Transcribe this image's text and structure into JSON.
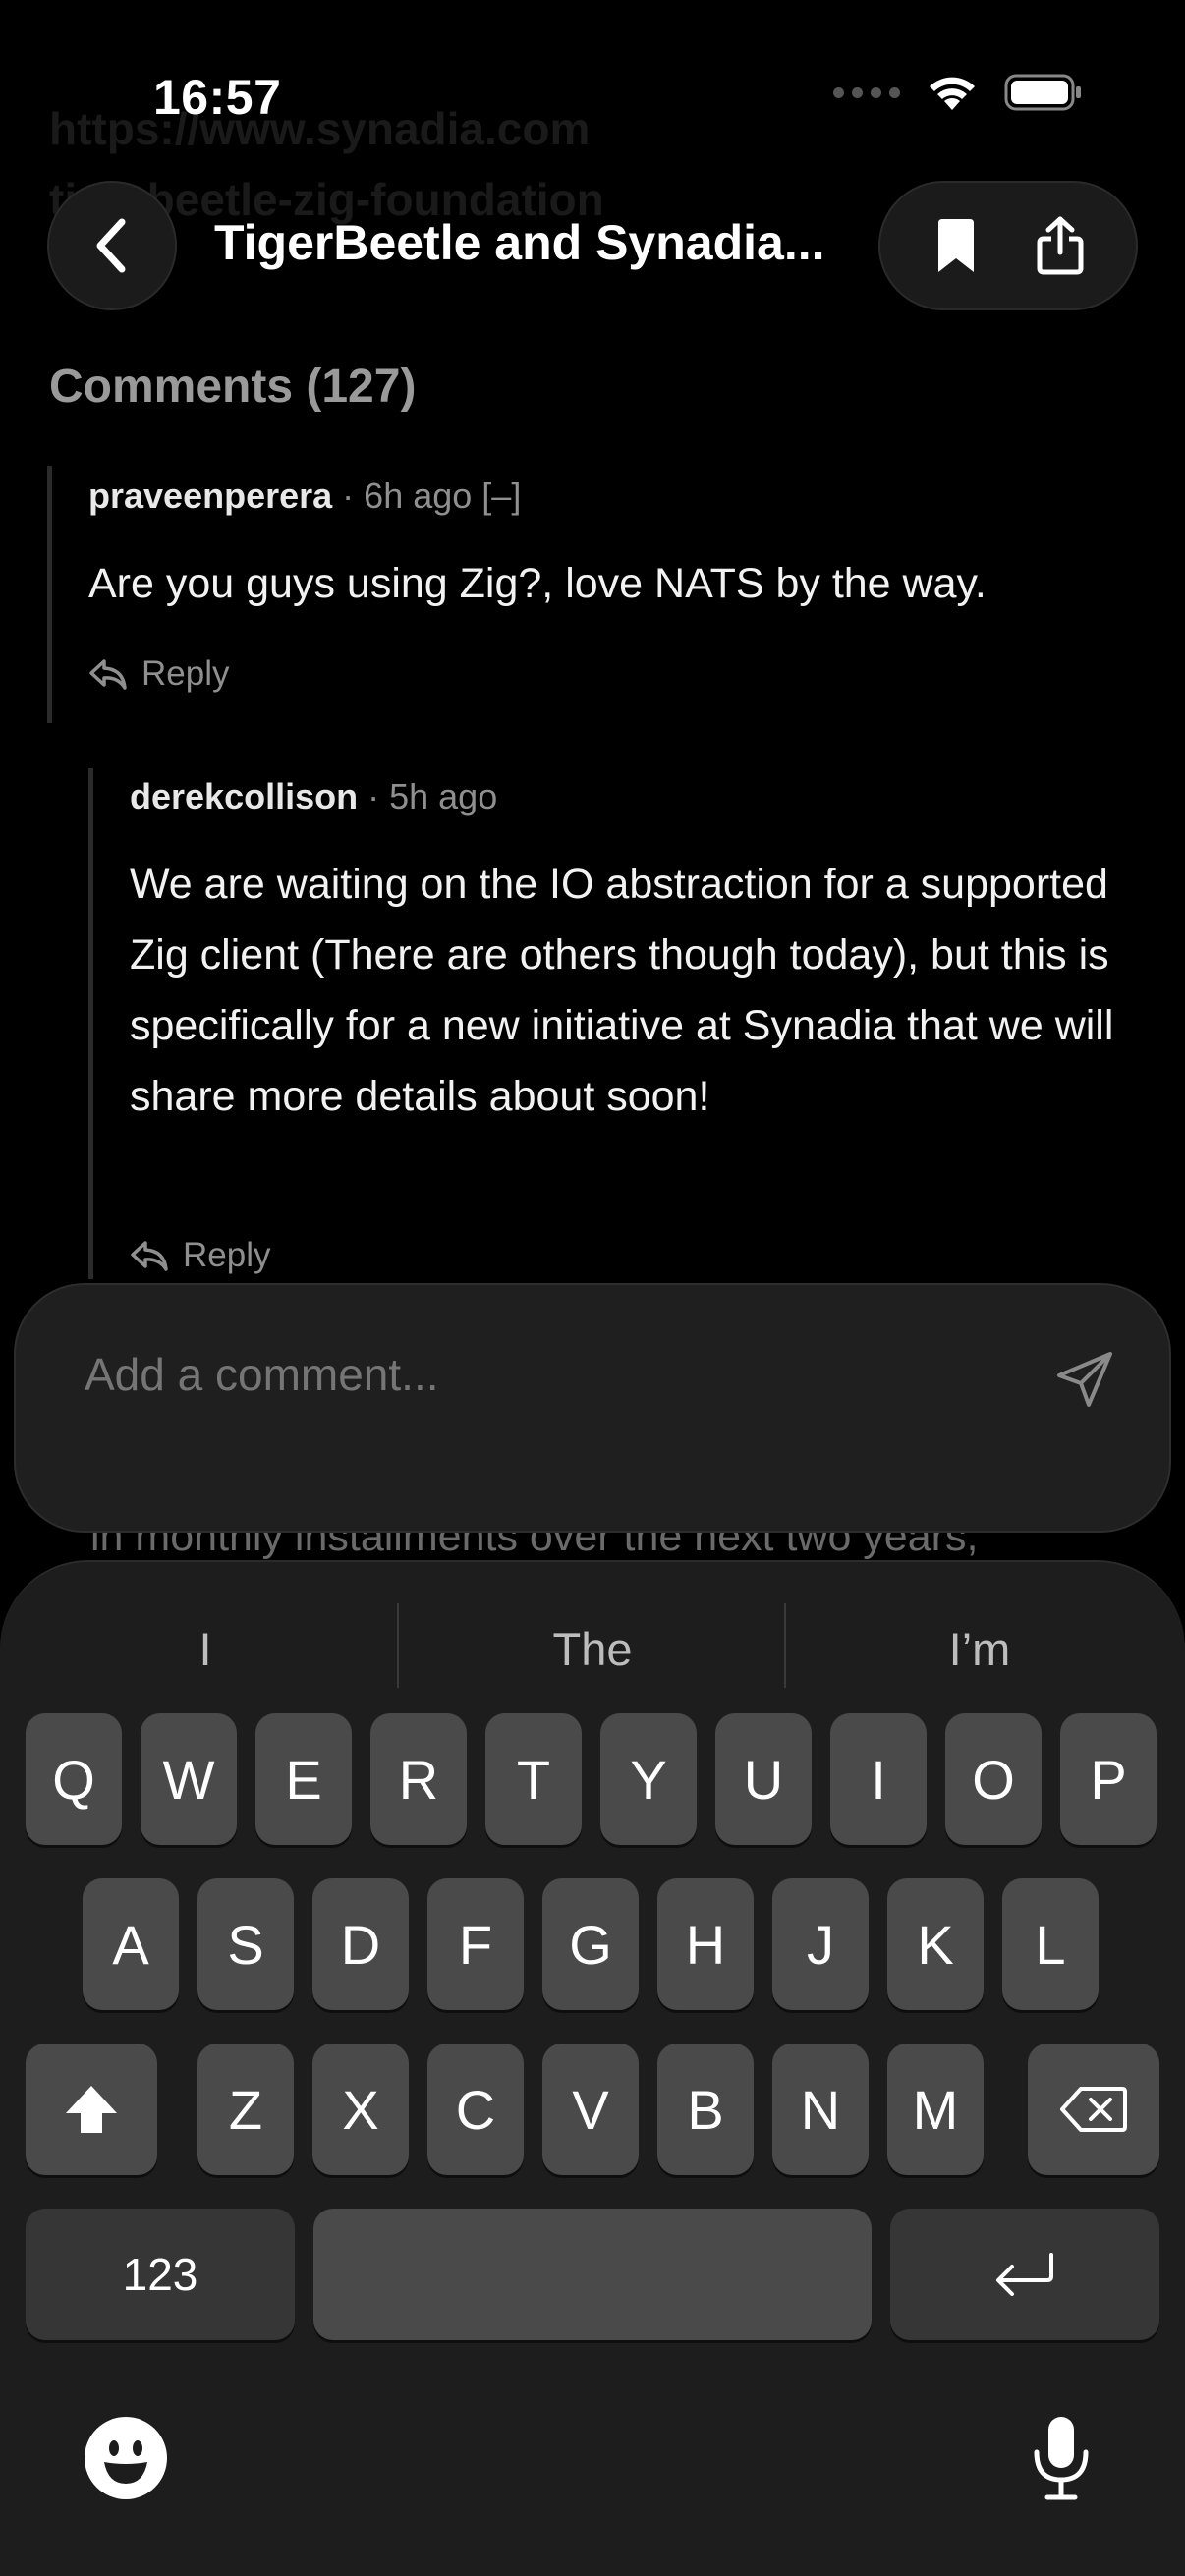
{
  "status_bar": {
    "time": "16:57"
  },
  "nav": {
    "title": "TigerBeetle and Synadia..."
  },
  "comments_heading": "Comments (127)",
  "comments": [
    {
      "author": "praveenperera",
      "age": "6h ago",
      "collapse": "[–]",
      "body": "Are you guys using Zig?, love NATS by the way.",
      "reply_label": "Reply"
    },
    {
      "author": "derekcollison",
      "age": "5h ago",
      "body": "We are waiting on the IO abstraction for a supported Zig client (There are others though today), but this is specifically for a new initiative at Synadia that we will share more details about soon!",
      "reply_label": "Reply"
    }
  ],
  "composer": {
    "placeholder": "Add a comment..."
  },
  "peek_text": "in monthly installments over the next two years,",
  "keyboard": {
    "suggestions": [
      "I",
      "The",
      "I’m"
    ],
    "row1": [
      "Q",
      "W",
      "E",
      "R",
      "T",
      "Y",
      "U",
      "I",
      "O",
      "P"
    ],
    "row2": [
      "A",
      "S",
      "D",
      "F",
      "G",
      "H",
      "J",
      "K",
      "L"
    ],
    "row3": [
      "Z",
      "X",
      "C",
      "V",
      "B",
      "N",
      "M"
    ],
    "numbers_label": "123"
  }
}
